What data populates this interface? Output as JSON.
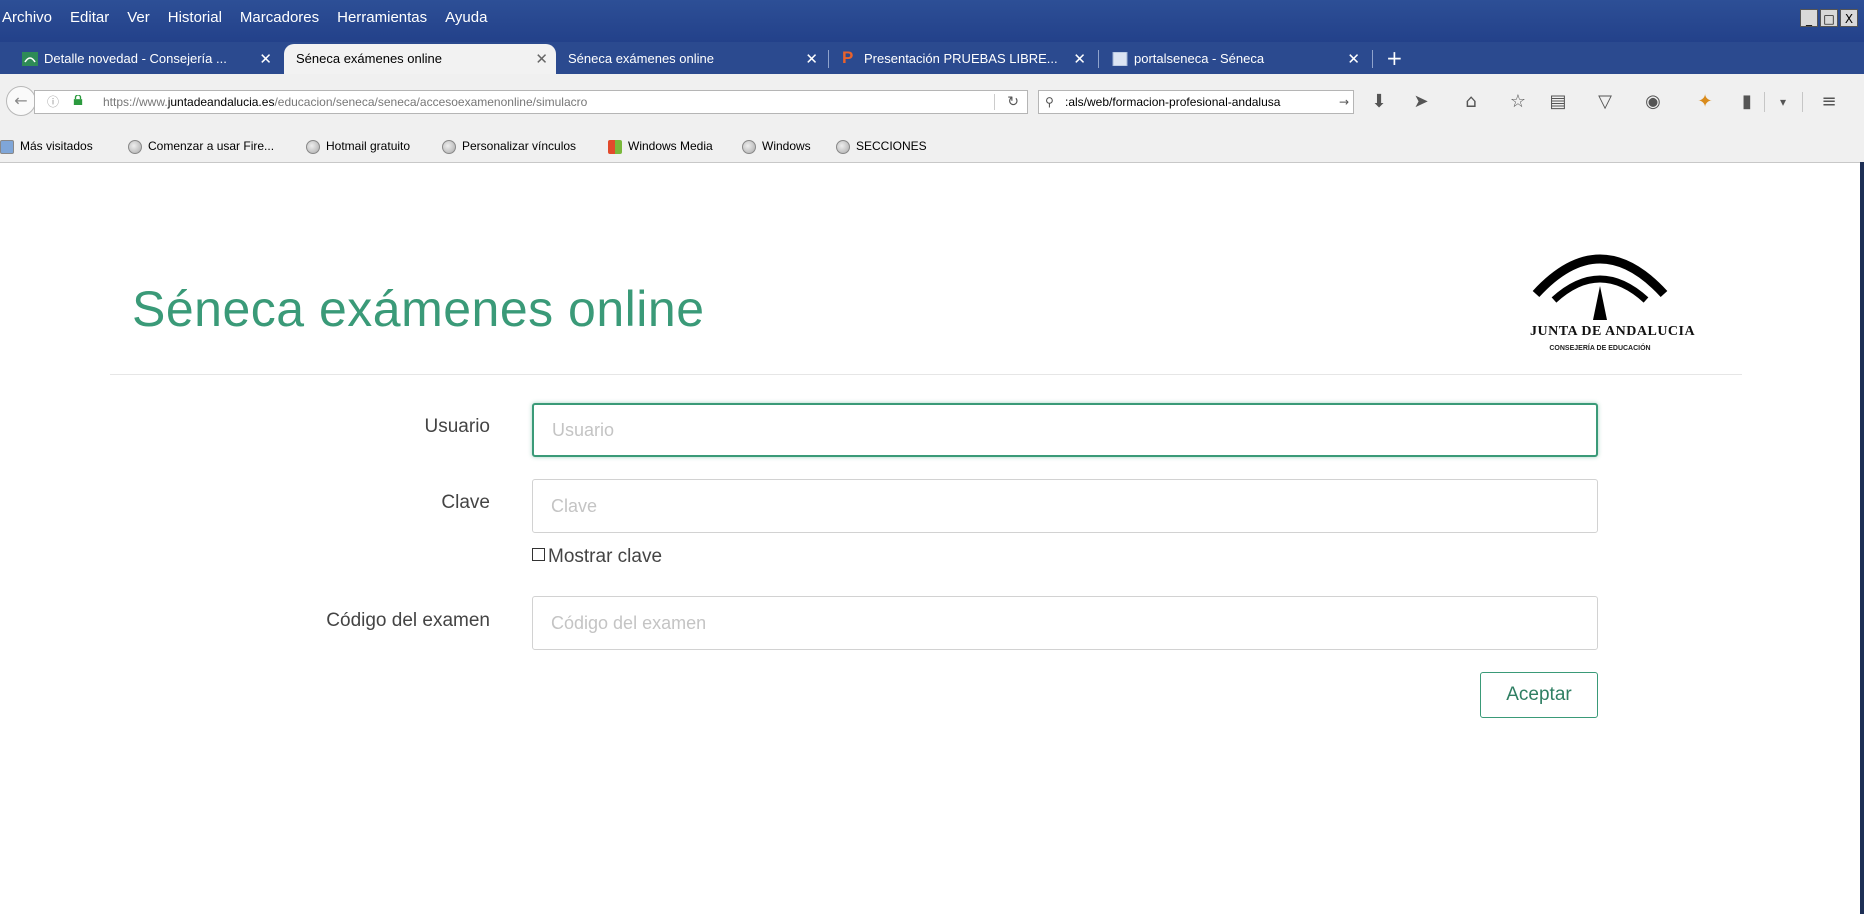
{
  "menubar": {
    "items": [
      "Archivo",
      "Editar",
      "Ver",
      "Historial",
      "Marcadores",
      "Herramientas",
      "Ayuda"
    ],
    "window_controls": [
      "_",
      "□",
      "X"
    ]
  },
  "tabs": [
    {
      "title": "Detalle novedad - Consejería ...",
      "active": false,
      "icon": "junta-favicon"
    },
    {
      "title": "Séneca exámenes online",
      "active": true,
      "icon": "none"
    },
    {
      "title": "Séneca exámenes online",
      "active": false,
      "icon": "none"
    },
    {
      "title": "Presentación PRUEBAS LIBRE...",
      "active": false,
      "icon": "powerpoint-p-icon"
    },
    {
      "title": "portalseneca - Séneca",
      "active": false,
      "icon": "page-icon"
    }
  ],
  "navbar": {
    "url_prefix": "https://www.",
    "url_domain": "juntadeandalucia.es",
    "url_path": "/educacion/seneca/seneca/accesoexamenonline/simulacro",
    "search_text": ":als/web/formacion-profesional-andalusa",
    "icons": [
      "download-icon",
      "send-icon",
      "home-icon",
      "star-icon",
      "clipboard-icon",
      "pocket-icon",
      "chat-icon",
      "extension-icon",
      "menu-icon"
    ]
  },
  "bookmarks": [
    {
      "label": "Más visitados",
      "icon": "bookmark-folder-icon"
    },
    {
      "label": "Comenzar a usar Fire...",
      "icon": "globe-icon"
    },
    {
      "label": "Hotmail gratuito",
      "icon": "globe-icon"
    },
    {
      "label": "Personalizar vínculos",
      "icon": "globe-icon"
    },
    {
      "label": "Windows Media",
      "icon": "windows-icon"
    },
    {
      "label": "Windows",
      "icon": "globe-icon"
    },
    {
      "label": "SECCIONES",
      "icon": "globe-icon"
    }
  ],
  "page": {
    "title": "Séneca exámenes online",
    "logo_text": "JUNTA DE ANDALUCIA",
    "logo_subtext": "CONSEJERÍA DE EDUCACIÓN",
    "accent_color": "#3a9a78",
    "form": {
      "usuario_label": "Usuario",
      "usuario_placeholder": "Usuario",
      "usuario_value": "",
      "clave_label": "Clave",
      "clave_placeholder": "Clave",
      "clave_value": "",
      "mostrar_clave_label": "Mostrar clave",
      "mostrar_clave_checked": false,
      "codigo_label": "Código del examen",
      "codigo_placeholder": "Código del examen",
      "codigo_value": "",
      "submit_label": "Aceptar"
    }
  }
}
